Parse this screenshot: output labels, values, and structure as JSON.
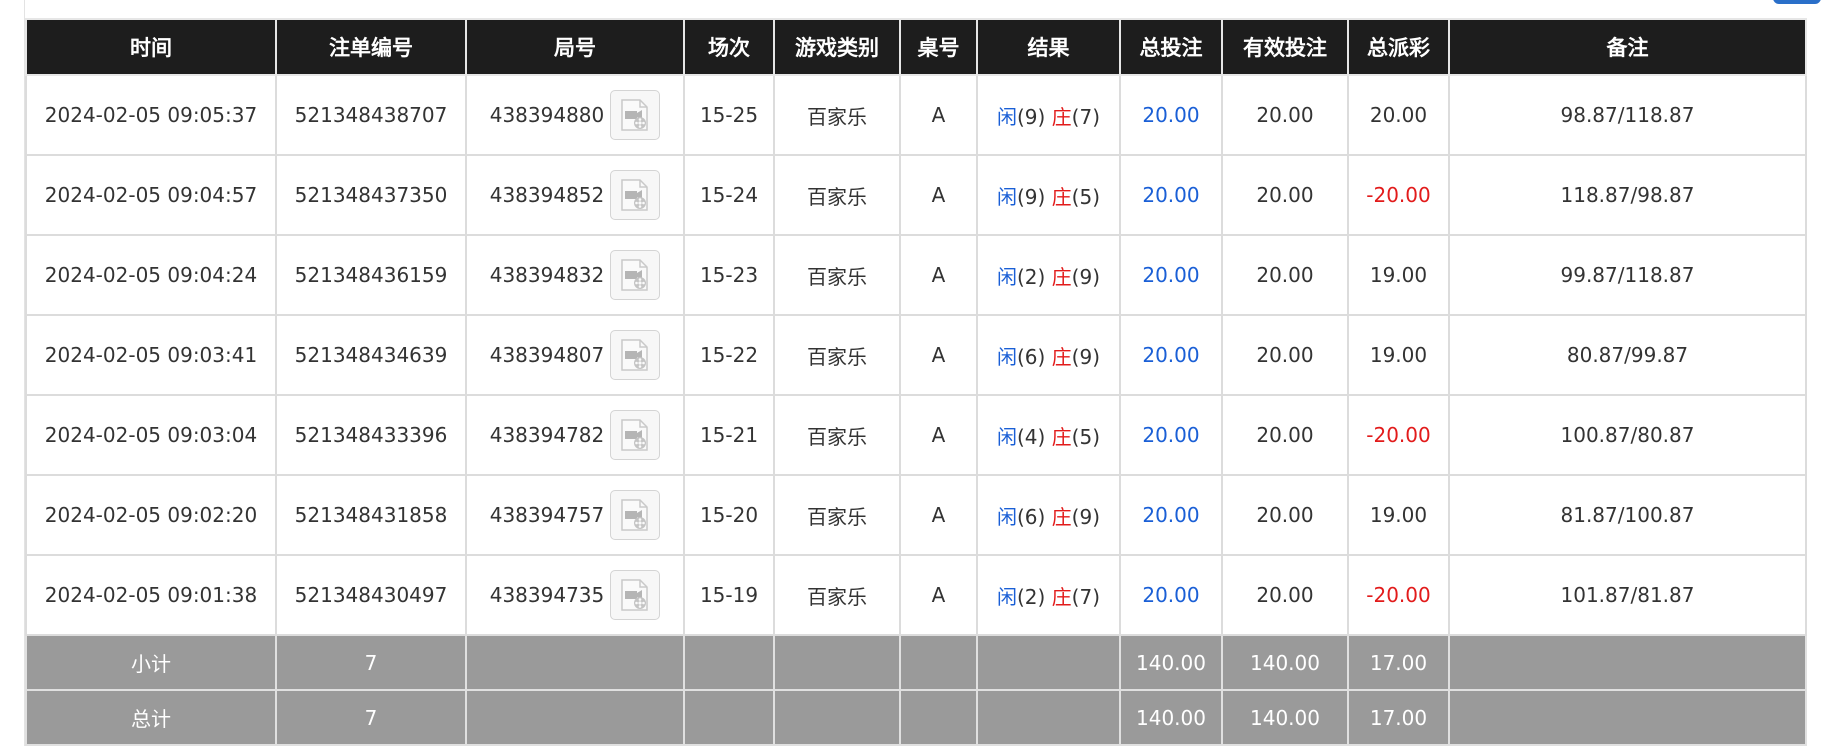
{
  "colors": {
    "header_bg": "#1d1d1d",
    "footer_bg": "#9a9a9a",
    "player": "#1a5fd6",
    "banker": "#e21b1b",
    "negative": "#e21b1b",
    "bet": "#1a5fd6"
  },
  "icons": {
    "round_video": "film-reel-icon"
  },
  "table": {
    "headers": [
      "时间",
      "注单编号",
      "局号",
      "场次",
      "游戏类别",
      "桌号",
      "结果",
      "总投注",
      "有效投注",
      "总派彩",
      "备注"
    ],
    "rows": [
      {
        "time": "2024-02-05 09:05:37",
        "bet_id": "521348438707",
        "round": "438394880",
        "session": "15-25",
        "game": "百家乐",
        "table": "A",
        "player_label": "闲",
        "player_val": "(9)",
        "banker_label": "庄",
        "banker_val": "(7)",
        "total_bet": "20.00",
        "valid_bet": "20.00",
        "payout": "20.00",
        "payout_negative": false,
        "note": "98.87/118.87"
      },
      {
        "time": "2024-02-05 09:04:57",
        "bet_id": "521348437350",
        "round": "438394852",
        "session": "15-24",
        "game": "百家乐",
        "table": "A",
        "player_label": "闲",
        "player_val": "(9)",
        "banker_label": "庄",
        "banker_val": "(5)",
        "total_bet": "20.00",
        "valid_bet": "20.00",
        "payout": "-20.00",
        "payout_negative": true,
        "note": "118.87/98.87"
      },
      {
        "time": "2024-02-05 09:04:24",
        "bet_id": "521348436159",
        "round": "438394832",
        "session": "15-23",
        "game": "百家乐",
        "table": "A",
        "player_label": "闲",
        "player_val": "(2)",
        "banker_label": "庄",
        "banker_val": "(9)",
        "total_bet": "20.00",
        "valid_bet": "20.00",
        "payout": "19.00",
        "payout_negative": false,
        "note": "99.87/118.87"
      },
      {
        "time": "2024-02-05 09:03:41",
        "bet_id": "521348434639",
        "round": "438394807",
        "session": "15-22",
        "game": "百家乐",
        "table": "A",
        "player_label": "闲",
        "player_val": "(6)",
        "banker_label": "庄",
        "banker_val": "(9)",
        "total_bet": "20.00",
        "valid_bet": "20.00",
        "payout": "19.00",
        "payout_negative": false,
        "note": "80.87/99.87"
      },
      {
        "time": "2024-02-05 09:03:04",
        "bet_id": "521348433396",
        "round": "438394782",
        "session": "15-21",
        "game": "百家乐",
        "table": "A",
        "player_label": "闲",
        "player_val": "(4)",
        "banker_label": "庄",
        "banker_val": "(5)",
        "total_bet": "20.00",
        "valid_bet": "20.00",
        "payout": "-20.00",
        "payout_negative": true,
        "note": "100.87/80.87"
      },
      {
        "time": "2024-02-05 09:02:20",
        "bet_id": "521348431858",
        "round": "438394757",
        "session": "15-20",
        "game": "百家乐",
        "table": "A",
        "player_label": "闲",
        "player_val": "(6)",
        "banker_label": "庄",
        "banker_val": "(9)",
        "total_bet": "20.00",
        "valid_bet": "20.00",
        "payout": "19.00",
        "payout_negative": false,
        "note": "81.87/100.87"
      },
      {
        "time": "2024-02-05 09:01:38",
        "bet_id": "521348430497",
        "round": "438394735",
        "session": "15-19",
        "game": "百家乐",
        "table": "A",
        "player_label": "闲",
        "player_val": "(2)",
        "banker_label": "庄",
        "banker_val": "(7)",
        "total_bet": "20.00",
        "valid_bet": "20.00",
        "payout": "-20.00",
        "payout_negative": true,
        "note": "101.87/81.87"
      }
    ],
    "subtotal": {
      "label": "小计",
      "count": "7",
      "total_bet": "140.00",
      "valid_bet": "140.00",
      "payout": "17.00"
    },
    "total": {
      "label": "总计",
      "count": "7",
      "total_bet": "140.00",
      "valid_bet": "140.00",
      "payout": "17.00"
    }
  }
}
